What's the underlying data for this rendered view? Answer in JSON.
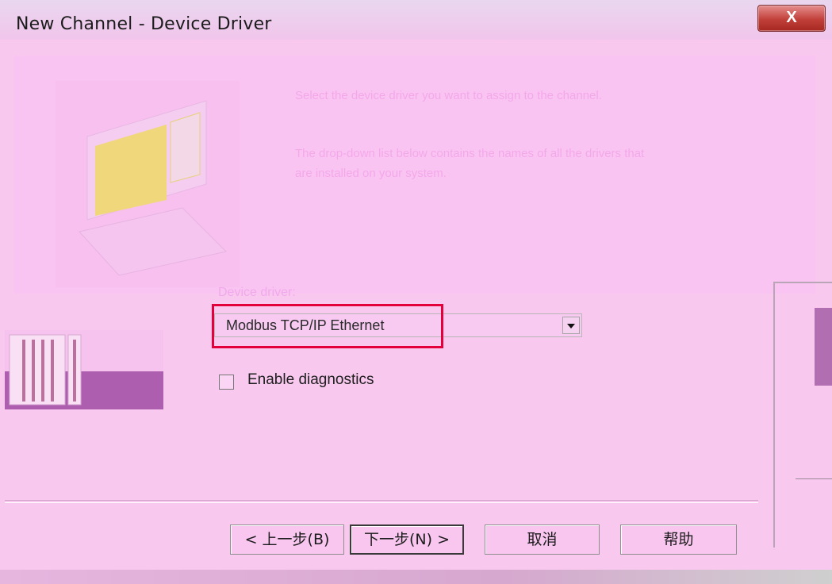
{
  "window": {
    "title": "New Channel - Device Driver",
    "close_label": "X"
  },
  "description": {
    "line1": "Select the device driver you want to assign to the channel.",
    "line2": "The drop-down list below contains the names of all the drivers that are installed on your system."
  },
  "form": {
    "driver_label": "Device driver:",
    "driver_value": "Modbus TCP/IP Ethernet",
    "diagnostics_label": "Enable diagnostics",
    "diagnostics_checked": false
  },
  "buttons": {
    "back": "< 上一步(B)",
    "next": "下一步(N) >",
    "cancel": "取消",
    "help": "帮助"
  },
  "icons": {
    "illustration": "computer-illustration-icon",
    "device": "plc-device-icon",
    "dropdown": "chevron-down-icon"
  }
}
